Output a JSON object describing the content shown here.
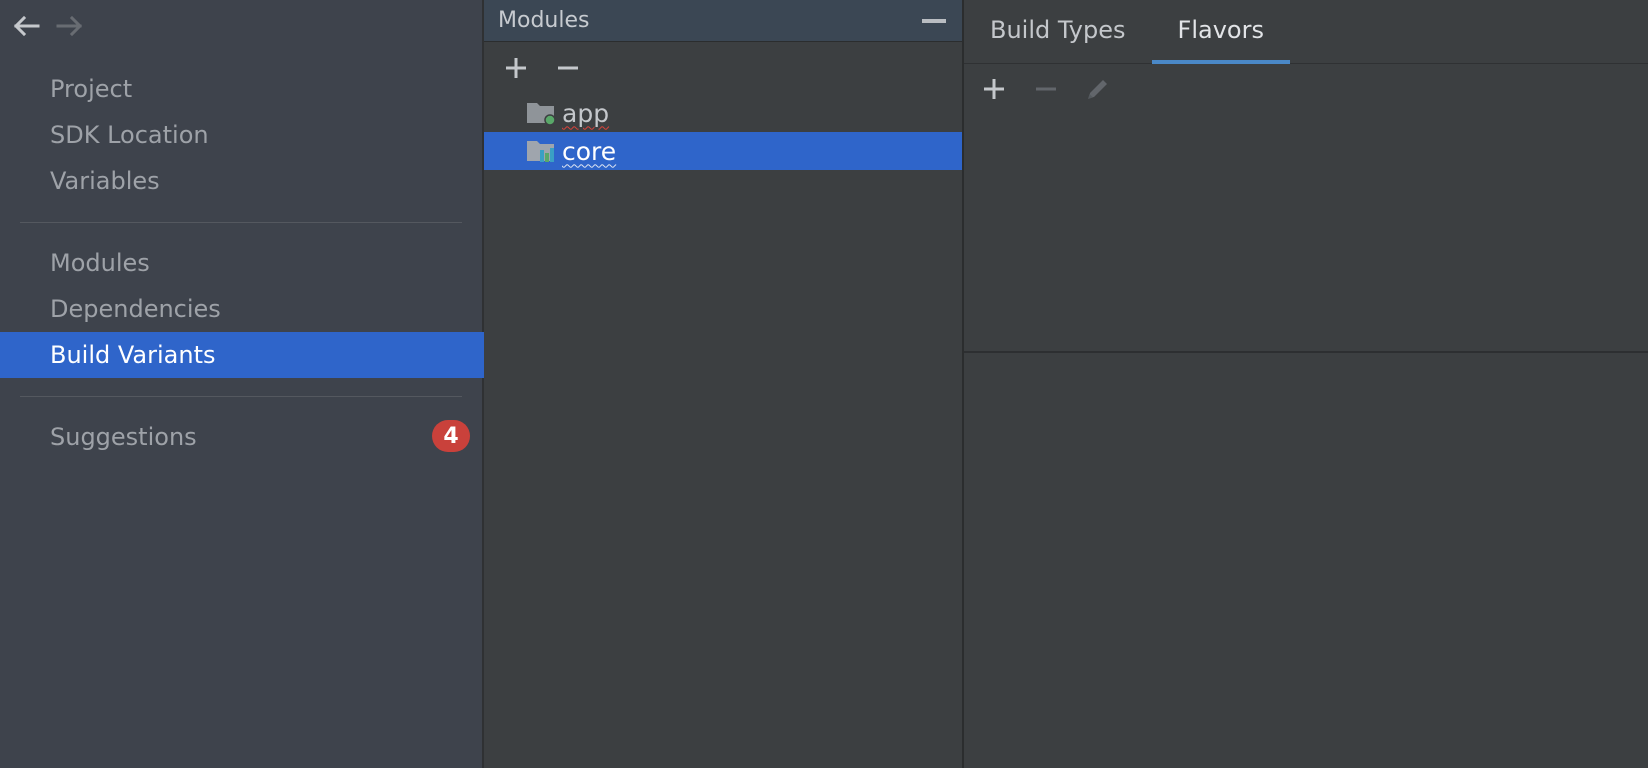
{
  "nav": {
    "back_icon": "arrow-left-icon",
    "forward_icon": "arrow-right-icon"
  },
  "sidebar": {
    "groups": [
      {
        "items": [
          {
            "label": "Project"
          },
          {
            "label": "SDK Location"
          },
          {
            "label": "Variables"
          }
        ]
      },
      {
        "items": [
          {
            "label": "Modules"
          },
          {
            "label": "Dependencies"
          },
          {
            "label": "Build Variants",
            "selected": true
          }
        ]
      },
      {
        "items": [
          {
            "label": "Suggestions",
            "badge": "4"
          }
        ]
      }
    ]
  },
  "modules": {
    "title": "Modules",
    "toolbar": {
      "add_icon": "plus-icon",
      "remove_icon": "minus-icon"
    },
    "items": [
      {
        "label": "app",
        "icon": "app-module-icon"
      },
      {
        "label": "core",
        "icon": "library-module-icon",
        "selected": true
      }
    ]
  },
  "right": {
    "tabs": [
      {
        "label": "Build Types"
      },
      {
        "label": "Flavors",
        "active": true
      }
    ],
    "toolbar": {
      "add_icon": "plus-icon",
      "remove_icon": "minus-icon",
      "edit_icon": "pencil-icon"
    }
  },
  "colors": {
    "selection": "#2f65ca",
    "tab_underline": "#4a88c7",
    "badge": "#c9413b"
  }
}
